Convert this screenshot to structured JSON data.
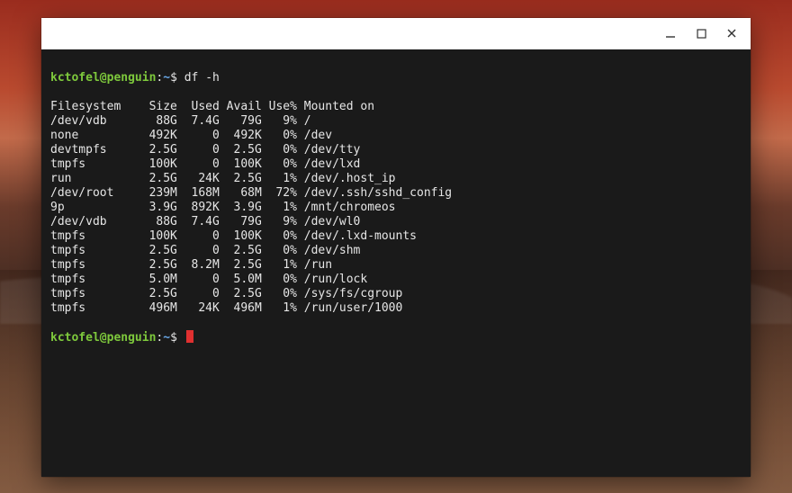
{
  "prompt": {
    "user_host": "kctofel@penguin",
    "separator": ":",
    "path": "~",
    "symbol": "$"
  },
  "command": "df -h",
  "header": {
    "filesystem": "Filesystem",
    "size": "Size",
    "used": "Used",
    "avail": "Avail",
    "usepct": "Use%",
    "mounted": "Mounted on"
  },
  "rows": [
    {
      "fs": "/dev/vdb",
      "size": "88G",
      "used": "7.4G",
      "avail": "79G",
      "usepct": "9%",
      "mount": "/"
    },
    {
      "fs": "none",
      "size": "492K",
      "used": "0",
      "avail": "492K",
      "usepct": "0%",
      "mount": "/dev"
    },
    {
      "fs": "devtmpfs",
      "size": "2.5G",
      "used": "0",
      "avail": "2.5G",
      "usepct": "0%",
      "mount": "/dev/tty"
    },
    {
      "fs": "tmpfs",
      "size": "100K",
      "used": "0",
      "avail": "100K",
      "usepct": "0%",
      "mount": "/dev/lxd"
    },
    {
      "fs": "run",
      "size": "2.5G",
      "used": "24K",
      "avail": "2.5G",
      "usepct": "1%",
      "mount": "/dev/.host_ip"
    },
    {
      "fs": "/dev/root",
      "size": "239M",
      "used": "168M",
      "avail": "68M",
      "usepct": "72%",
      "mount": "/dev/.ssh/sshd_config"
    },
    {
      "fs": "9p",
      "size": "3.9G",
      "used": "892K",
      "avail": "3.9G",
      "usepct": "1%",
      "mount": "/mnt/chromeos"
    },
    {
      "fs": "/dev/vdb",
      "size": "88G",
      "used": "7.4G",
      "avail": "79G",
      "usepct": "9%",
      "mount": "/dev/wl0"
    },
    {
      "fs": "tmpfs",
      "size": "100K",
      "used": "0",
      "avail": "100K",
      "usepct": "0%",
      "mount": "/dev/.lxd-mounts"
    },
    {
      "fs": "tmpfs",
      "size": "2.5G",
      "used": "0",
      "avail": "2.5G",
      "usepct": "0%",
      "mount": "/dev/shm"
    },
    {
      "fs": "tmpfs",
      "size": "2.5G",
      "used": "8.2M",
      "avail": "2.5G",
      "usepct": "1%",
      "mount": "/run"
    },
    {
      "fs": "tmpfs",
      "size": "5.0M",
      "used": "0",
      "avail": "5.0M",
      "usepct": "0%",
      "mount": "/run/lock"
    },
    {
      "fs": "tmpfs",
      "size": "2.5G",
      "used": "0",
      "avail": "2.5G",
      "usepct": "0%",
      "mount": "/sys/fs/cgroup"
    },
    {
      "fs": "tmpfs",
      "size": "496M",
      "used": "24K",
      "avail": "496M",
      "usepct": "1%",
      "mount": "/run/user/1000"
    }
  ],
  "colwidths": {
    "fs": 12,
    "size": 6,
    "used": 6,
    "avail": 6,
    "usepct": 5
  }
}
